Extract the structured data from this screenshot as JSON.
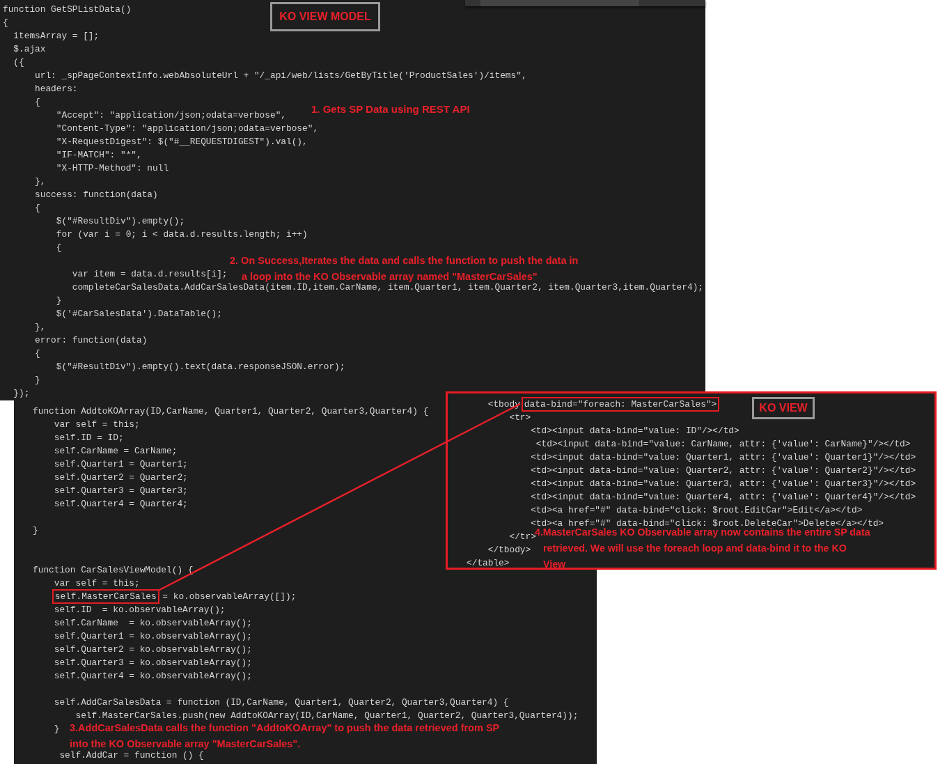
{
  "view_model_code": {
    "lines": [
      "function GetSPListData()",
      "{",
      "  itemsArray = [];",
      "  $.ajax",
      "  ({",
      "      url: _spPageContextInfo.webAbsoluteUrl + \"/_api/web/lists/GetByTitle('ProductSales')/items\",",
      "      headers:",
      "      {",
      "          \"Accept\": \"application/json;odata=verbose\",",
      "          \"Content-Type\": \"application/json;odata=verbose\",",
      "          \"X-RequestDigest\": $(\"#__REQUESTDIGEST\").val(),",
      "          \"IF-MATCH\": \"*\",",
      "          \"X-HTTP-Method\": null",
      "      },",
      "      success: function(data)",
      "      {",
      "          $(\"#ResultDiv\").empty();",
      "          for (var i = 0; i < data.d.results.length; i++)",
      "          {",
      {
        "kind": "blank"
      },
      "             var item = data.d.results[i];",
      "             completeCarSalesData.AddCarSalesData(item.ID,item.CarName, item.Quarter1, item.Quarter2, item.Quarter3,item.Quarter4);",
      "          }",
      "          $('#CarSalesData').DataTable();",
      "      },",
      "      error: function(data)",
      "      {",
      "          $(\"#ResultDiv\").empty().text(data.responseJSON.error);",
      "      }",
      "  });"
    ]
  },
  "view_model_code_continued": {
    "lines": [
      "   function AddtoKOArray(ID,CarName, Quarter1, Quarter2, Quarter3,Quarter4) {",
      "       var self = this;",
      "       self.ID = ID;",
      "       self.CarName = CarName;",
      "       self.Quarter1 = Quarter1;",
      "       self.Quarter2 = Quarter2;",
      "       self.Quarter3 = Quarter3;",
      "       self.Quarter4 = Quarter4;",
      {
        "kind": "blank"
      },
      "   }",
      {
        "kind": "blank"
      },
      {
        "kind": "blank"
      },
      "   function CarSalesViewModel() {",
      "       var self = this;",
      {
        "kind": "highlighted",
        "parts": [
          {
            "text": "self.MasterCarSales",
            "boxed": true
          },
          {
            "text": " = ko.observableArray([]);",
            "boxed": false
          }
        ]
      },
      "       self.ID  = ko.observableArray();",
      "       self.CarName  = ko.observableArray();",
      "       self.Quarter1 = ko.observableArray();",
      "       self.Quarter2 = ko.observableArray();",
      "       self.Quarter3 = ko.observableArray();",
      "       self.Quarter4 = ko.observableArray();",
      {
        "kind": "blank"
      },
      "       self.AddCarSalesData = function (ID,CarName, Quarter1, Quarter2, Quarter3,Quarter4) {",
      "           self.MasterCarSales.push(new AddtoKOArray(ID,CarName, Quarter1, Quarter2, Quarter3,Quarter4));",
      "       }",
      {
        "kind": "blank"
      },
      "        self.AddCar = function () {"
    ]
  },
  "view_code": {
    "lines": [
      {
        "kind": "highlighted",
        "parts": [
          {
            "text": "       <tbody",
            "boxed": false
          },
          {
            "text": "data-bind=\"foreach: MasterCarSales\">",
            "boxed": true
          }
        ]
      },
      "           <tr>",
      "               <td><input data-bind=\"value: ID\"/></td>",
      "                <td><input data-bind=\"value: CarName, attr: {'value': CarName}\"/></td>",
      "               <td><input data-bind=\"value: Quarter1, attr: {'value': Quarter1}\"/></td>",
      "               <td><input data-bind=\"value: Quarter2, attr: {'value': Quarter2}\"/></td>",
      "               <td><input data-bind=\"value: Quarter3, attr: {'value': Quarter3}\"/></td>",
      "               <td><input data-bind=\"value: Quarter4, attr: {'value': Quarter4}\"/></td>",
      "               <td><a href=\"#\" data-bind=\"click: $root.EditCar\">Edit</a></td>",
      "               <td><a href=\"#\" data-bind=\"click: $root.DeleteCar\">Delete</a></td>",
      "           </tr>",
      "       </tbody>",
      "   </table>"
    ]
  },
  "section_labels": [
    "KO VIEW MODEL",
    "KO VIEW"
  ],
  "annotations": [
    {
      "lines": [
        "1. Gets SP Data using REST API"
      ]
    },
    {
      "lines": [
        "2. On Success,Iterates the data and calls the function to push the data in",
        "a loop into  the KO Observable array named \"MasterCarSales\""
      ]
    },
    {
      "lines": [
        "3.AddCarSalesData calls the function \"AddtoKOArray\" to push the data retrieved from SP",
        "into the KO Observable array \"MasterCarSales\"."
      ]
    },
    {
      "lines": [
        "4.MasterCarSales KO Observable array now contains the entire SP data",
        "retrieved. We will use the foreach loop and data-bind it to the KO",
        "View"
      ]
    }
  ]
}
